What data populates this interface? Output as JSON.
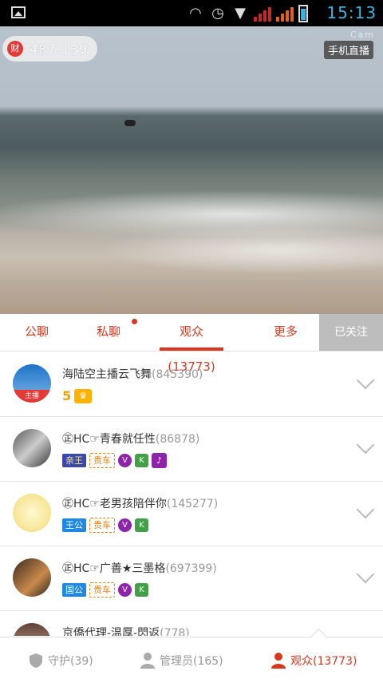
{
  "status_bar": {
    "time": "15:13"
  },
  "video": {
    "wealth_value": "487.139",
    "wealth_icon_label": "财",
    "watermark": "Cam",
    "live_badge": "手机直播"
  },
  "tabs": [
    {
      "label": "公聊",
      "active": false
    },
    {
      "label": "私聊",
      "active": false,
      "has_dot": true
    },
    {
      "label": "观众(13773)",
      "active": true
    },
    {
      "label": "更多",
      "active": false
    }
  ],
  "follow_button": "已关注",
  "audience": [
    {
      "name": "海陆空主播云飞舞",
      "id": "(845390)",
      "host_tag": "主播",
      "level": "5"
    },
    {
      "name": "㊣HC☞青春就任性",
      "id": "(86878)",
      "badges": [
        "亲王",
        "贵车",
        "V",
        "K",
        "♪"
      ]
    },
    {
      "name": "㊣HC☞老男孩陪伴你",
      "id": "(145277)",
      "badges": [
        "王公",
        "贵车",
        "V",
        "K"
      ]
    },
    {
      "name": "㊣HC☞广善★三墨格",
      "id": "(697399)",
      "badges": [
        "国公",
        "贵车",
        "V",
        "K"
      ]
    },
    {
      "name": "京僑代理-温厚-閃返",
      "id": "(778)"
    }
  ],
  "bottom_tabs": [
    {
      "label": "守护(39)",
      "icon": "shield-icon",
      "color": "#999999"
    },
    {
      "label": "管理员(165)",
      "icon": "person-icon",
      "color": "#999999"
    },
    {
      "label": "观众(13773)",
      "icon": "person-icon",
      "color": "#d9381e",
      "active": true
    }
  ],
  "colors": {
    "accent": "#d9381e",
    "follow_bg": "#bdbdbd",
    "status_blue": "#33b5e5"
  }
}
